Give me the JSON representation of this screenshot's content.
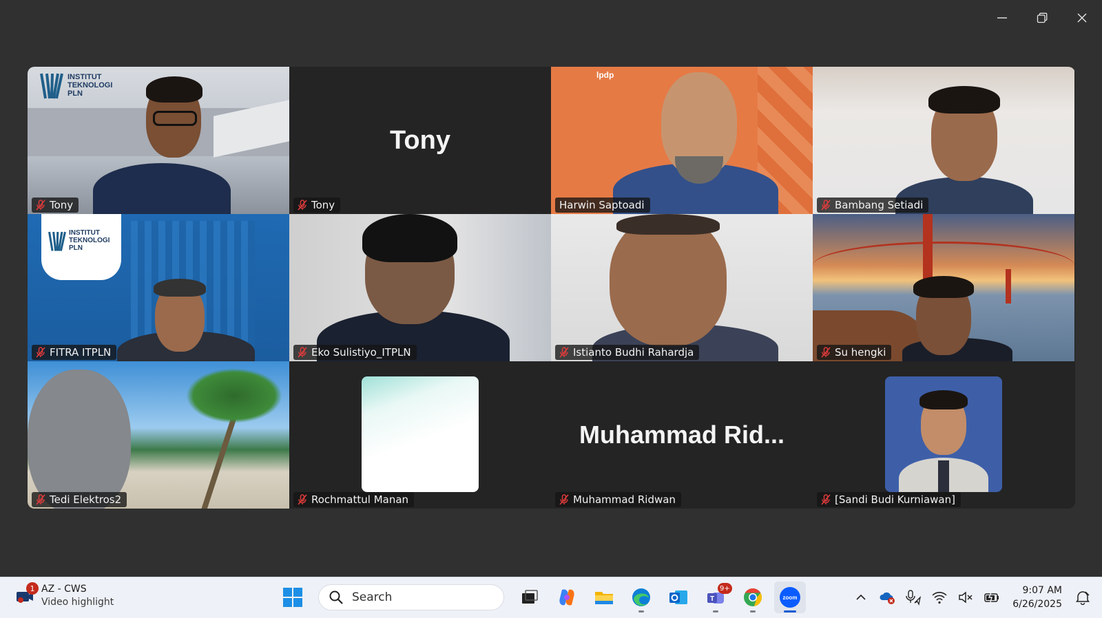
{
  "window": {
    "controls": [
      "minimize",
      "restore",
      "close"
    ]
  },
  "participants": [
    {
      "name": "Tony",
      "muted": true,
      "video": true,
      "active": false
    },
    {
      "name": "Tony",
      "muted": true,
      "video": false,
      "display_name": "Tony",
      "active": false
    },
    {
      "name": "Harwin Saptoadi",
      "muted": false,
      "video": true,
      "active": true
    },
    {
      "name": "Bambang Setiadi",
      "muted": true,
      "video": true,
      "active": false
    },
    {
      "name": "FITRA ITPLN",
      "muted": true,
      "video": true,
      "active": false
    },
    {
      "name": "Eko Sulistiyo_ITPLN",
      "muted": true,
      "video": true,
      "active": false
    },
    {
      "name": "Istianto Budhi Rahardja",
      "muted": true,
      "video": true,
      "active": false
    },
    {
      "name": "Su hengki",
      "muted": true,
      "video": true,
      "active": false
    },
    {
      "name": "Tedi Elektros2",
      "muted": true,
      "video": true,
      "active": false
    },
    {
      "name": "Rochmattul Manan",
      "muted": true,
      "video": false,
      "active": false
    },
    {
      "name": "Muhammad Ridwan",
      "muted": true,
      "video": false,
      "display_name": "Muhammad  Rid...",
      "active": false
    },
    {
      "name": "[Sandi Budi Kurniawan]",
      "muted": true,
      "video": false,
      "active": false
    }
  ],
  "backgrounds": {
    "itpln_logo": "INSTITUT TEKNOLOGI PLN",
    "lpdp_logo": "lpdp",
    "building_sign": "OLOGI PLN"
  },
  "taskbar": {
    "notification": {
      "title": "AZ - CWS",
      "subtitle": "Video highlight",
      "badge": "1"
    },
    "search_placeholder": "Search",
    "apps": [
      "start",
      "search",
      "task-view",
      "copilot",
      "file-explorer",
      "edge",
      "outlook",
      "teams",
      "chrome",
      "zoom"
    ],
    "teams_badge": "9+",
    "time": "9:07 AM",
    "date": "6/26/2025"
  },
  "colors": {
    "active_speaker_border": "#22d17e",
    "muted_icon": "#e03b3b",
    "background": "#303030"
  }
}
